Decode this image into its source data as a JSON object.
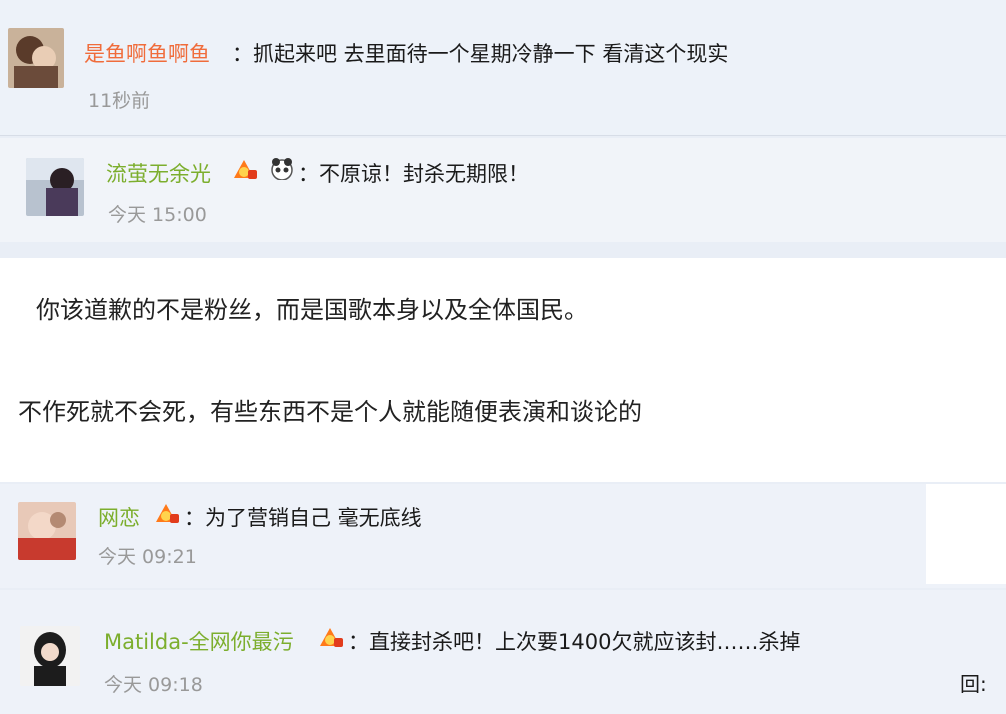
{
  "comments": [
    {
      "user": "是鱼啊鱼啊鱼",
      "text": "：抓起来吧 去里面待一个星期冷静一下 看清这个现实",
      "time": "11秒前"
    },
    {
      "user": "流萤无余光",
      "text": "：不原谅！封杀无期限！",
      "time": "今天 15:00"
    },
    {
      "user": "网恋",
      "text": "：为了营销自己 毫无底线",
      "time": "今天 09:21"
    },
    {
      "user": "Matilda-全网你最污",
      "text": "：直接封杀吧！上次要1400欠就应该封……杀掉",
      "time": "今天 09:18"
    }
  ],
  "article": {
    "line1": "你该道歉的不是粉丝，而是国歌本身以及全体国民。",
    "line2": "不作死就不会死，有些东西不是个人就能随便表演和谈论的"
  },
  "reply_label": "回:",
  "colors": {
    "name_orange": "#f06c3b",
    "name_green": "#7cae2d",
    "time_gray": "#999999"
  },
  "icons": [
    "vip-badge-icon",
    "panda-icon"
  ]
}
